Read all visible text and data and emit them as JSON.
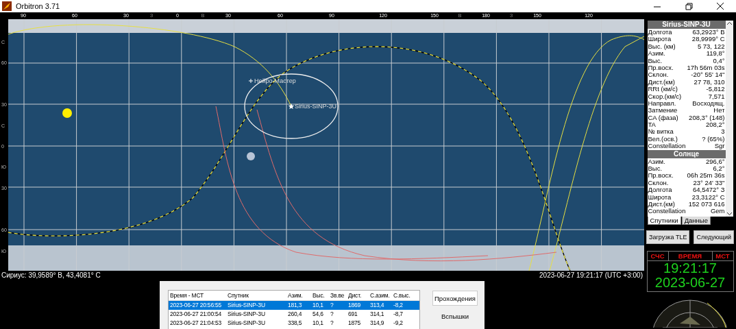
{
  "window": {
    "title": "Orbitron 3.71"
  },
  "map": {
    "top_labels": [
      "90",
      "60",
      "30",
      "З",
      "0",
      "В",
      "30",
      "60",
      "90",
      "120",
      "150",
      "В",
      "180",
      "З",
      "150",
      "120"
    ],
    "side_labels": [
      "С",
      "60",
      "30",
      "С",
      "0",
      "Ю",
      "30",
      "60",
      "Ю"
    ],
    "markers": [
      {
        "kind": "station",
        "label": "Нейро-Мастер"
      },
      {
        "kind": "satellite",
        "label": "Sirius-SINP-3U"
      }
    ]
  },
  "status_bar": {
    "position": "Сириус: 39,9589° В, 43,4081° С",
    "datetime": "2023-06-27 19:21:17 (UTC +3:00)"
  },
  "info_panel": {
    "sections": [
      {
        "title": "Sirius-SINP-3U",
        "rows": [
          {
            "label": "Долгота",
            "value": "63,2923° В"
          },
          {
            "label": "Широта",
            "value": "28,9999° С"
          },
          {
            "label": "Выс. (км)",
            "value": "5 73, 122"
          },
          {
            "label": "Азим.",
            "value": "119,8°"
          },
          {
            "label": "Выс.",
            "value": "0,4°"
          },
          {
            "label": "Пр.восх.",
            "value": "17h 56m 03s"
          },
          {
            "label": "Склон.",
            "value": "-20° 55' 14\""
          },
          {
            "label": "Дист.(км)",
            "value": "27 78, 310"
          },
          {
            "label": "RRt (км/с)",
            "value": "-5,812"
          },
          {
            "label": "Скор.(км/с)",
            "value": "7,571"
          },
          {
            "label": "Направл.",
            "value": "Восходящ."
          },
          {
            "label": "Затмение",
            "value": "Нет"
          },
          {
            "label": "CA (фаза)",
            "value": "208,3° (148)"
          },
          {
            "label": "TA",
            "value": "208,2°"
          },
          {
            "label": "№ витка",
            "value": "3"
          },
          {
            "label": "Вел.(осв.)",
            "value": "? (65%)"
          },
          {
            "label": "Constellation",
            "value": "Sgr"
          }
        ]
      },
      {
        "title": "Солнце",
        "rows": [
          {
            "label": "Азим.",
            "value": "296,6°"
          },
          {
            "label": "Выс.",
            "value": "6,2°"
          },
          {
            "label": "Пр.восх.",
            "value": "06h 25m 36s"
          },
          {
            "label": "Склон.",
            "value": "23° 24' 33\""
          },
          {
            "label": "Долгота",
            "value": "64,5472° З"
          },
          {
            "label": "Широта",
            "value": "23,3122° С"
          },
          {
            "label": "Дист.(км)",
            "value": "152 073 616"
          },
          {
            "label": "Constellation",
            "value": "Gem"
          }
        ]
      }
    ]
  },
  "tabs": [
    {
      "label": "Спутники",
      "selected": true
    },
    {
      "label": "Данные",
      "selected": false
    }
  ],
  "buttons": [
    "Загрузка TLE",
    "Следующий"
  ],
  "clock": {
    "headers": [
      "СЧС",
      "ВРЕМЯ",
      "МСТ"
    ],
    "time": "19:21:17",
    "date": "2023-06-27"
  },
  "passes": {
    "columns": [
      "Время - МСТ",
      "Спутник",
      "Азим.",
      "Выс.",
      "Зв.ве",
      "Дист.",
      "С.азим.",
      "С.выс."
    ],
    "rows": [
      {
        "cells": [
          "2023-06-27 20:56:55",
          "Sirius-SINP-3U",
          "181,3",
          "10,1",
          "?",
          "1869",
          "313,4",
          "-8,2"
        ],
        "selected": true
      },
      {
        "cells": [
          "2023-06-27 21:00:54",
          "Sirius-SINP-3U",
          "260,4",
          "54,6",
          "?",
          "691",
          "314,1",
          "-8,7"
        ],
        "selected": false
      },
      {
        "cells": [
          "2023-06-27 21:04:53",
          "Sirius-SINP-3U",
          "338,5",
          "10,1",
          "?",
          "1875",
          "314,9",
          "-9,2"
        ],
        "selected": false
      }
    ],
    "side_buttons": [
      {
        "label": "Прохождения",
        "selected": true
      },
      {
        "label": "Вспышки",
        "selected": false
      }
    ]
  }
}
